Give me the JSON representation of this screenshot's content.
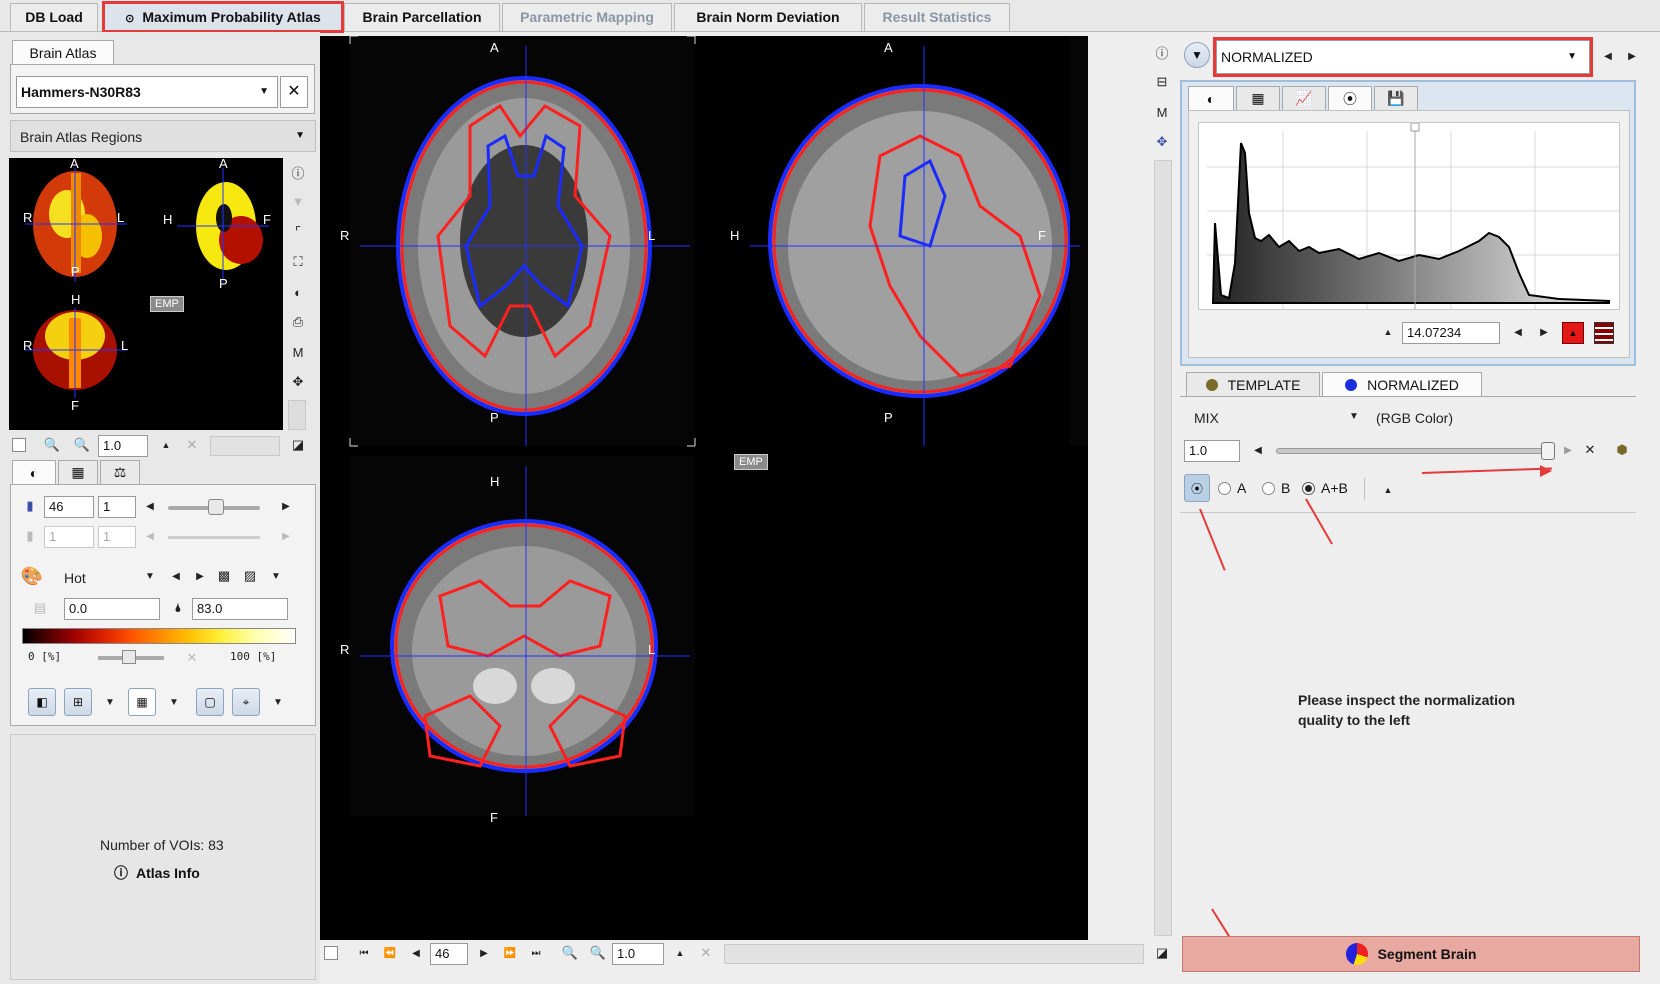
{
  "tabs": [
    {
      "label": "DB Load",
      "state": "normal"
    },
    {
      "label": "Maximum Probability Atlas",
      "state": "active"
    },
    {
      "label": "Brain Parcellation",
      "state": "normal"
    },
    {
      "label": "Parametric Mapping",
      "state": "disabled"
    },
    {
      "label": "Brain Norm Deviation",
      "state": "normal"
    },
    {
      "label": "Result Statistics",
      "state": "disabled"
    }
  ],
  "left": {
    "atlas_tab": "Brain Atlas",
    "atlas_value": "Hammers-N30R83",
    "regions_label": "Brain Atlas Regions",
    "emp": "EMP",
    "zoom_value": "1.0",
    "slice_value": "46",
    "slice_step": "1",
    "slice2_value": "1",
    "slice2_step": "1",
    "colormap": "Hot",
    "min_value": "0.0",
    "max_value": "83.0",
    "pct_min": "0 [%]",
    "pct_max": "100 [%]",
    "num_vois": "Number of VOIs: 83",
    "atlas_info": "Atlas Info",
    "orientation": {
      "A": "A",
      "P": "P",
      "R": "R",
      "L": "L",
      "H": "H",
      "F": "F"
    }
  },
  "center": {
    "emp": "EMP",
    "slice_value": "46",
    "zoom_value": "1.0",
    "labels": {
      "A": "A",
      "P": "P",
      "R": "R",
      "L": "L",
      "H": "H",
      "F": "F"
    }
  },
  "right": {
    "dataset": "NORMALIZED",
    "histogram_value": "14.07234",
    "layer_tab_template": "TEMPLATE",
    "layer_tab_normalized": "NORMALIZED",
    "mix_label": "MIX",
    "mix_mode": "(RGB Color)",
    "fusion_value": "1.0",
    "radio_a": "A",
    "radio_b": "B",
    "radio_ab": "A+B",
    "radio_selected": "A+B",
    "message": "Please inspect the normalization quality to the left",
    "segment_button": "Segment Brain",
    "colors": {
      "highlight": "#e53a3a",
      "segment_bg": "#e8aaa0",
      "contour_red": "#ff2020",
      "contour_blue": "#1a2bff"
    }
  }
}
